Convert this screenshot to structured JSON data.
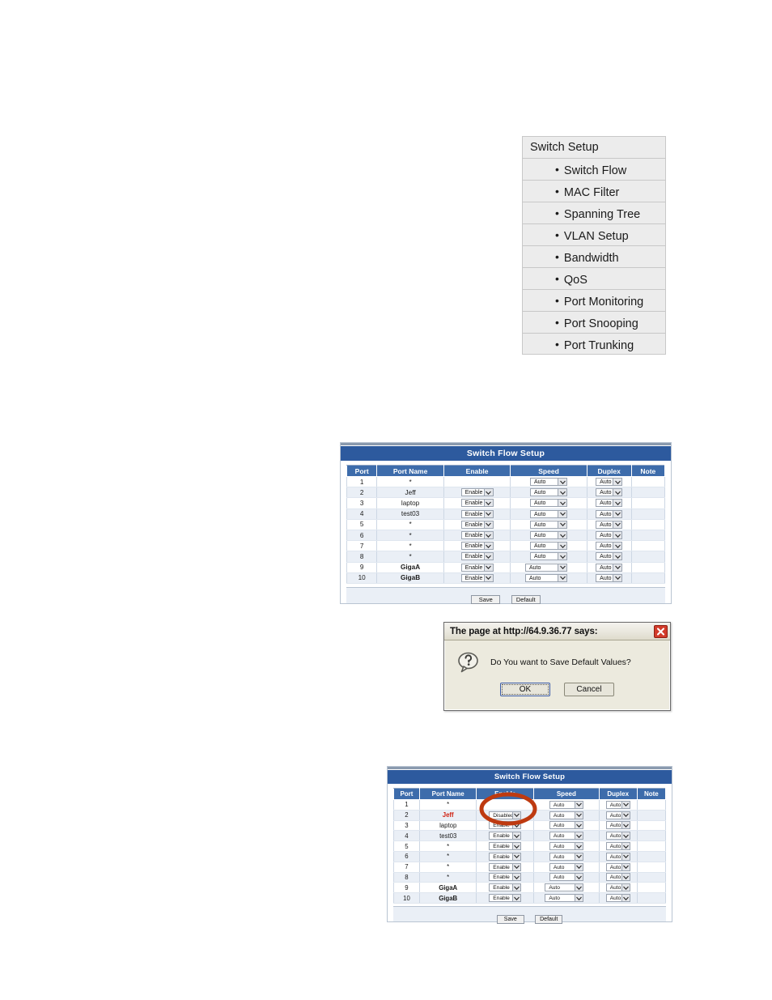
{
  "menu": {
    "title": "Switch Setup",
    "items": [
      "Switch Flow",
      "MAC Filter",
      "Spanning Tree",
      "VLAN Setup",
      "Bandwidth",
      "QoS",
      "Port Monitoring",
      "Port Snooping",
      "Port Trunking"
    ],
    "bullet": "•"
  },
  "table1": {
    "title": "Switch Flow Setup",
    "columns": [
      "Port",
      "Port Name",
      "Enable",
      "Speed",
      "Duplex",
      "Note"
    ],
    "rows": [
      {
        "port": "1",
        "name": "*",
        "enable": "",
        "speed": "Auto",
        "duplex": "Auto",
        "note": "",
        "name_style": "normal",
        "has_enable": false,
        "wide_speed": false
      },
      {
        "port": "2",
        "name": "Jeff",
        "enable": "Enable",
        "speed": "Auto",
        "duplex": "Auto",
        "note": "",
        "name_style": "normal",
        "has_enable": true,
        "wide_speed": false
      },
      {
        "port": "3",
        "name": "laptop",
        "enable": "Enable",
        "speed": "Auto",
        "duplex": "Auto",
        "note": "",
        "name_style": "normal",
        "has_enable": true,
        "wide_speed": false
      },
      {
        "port": "4",
        "name": "test03",
        "enable": "Enable",
        "speed": "Auto",
        "duplex": "Auto",
        "note": "",
        "name_style": "normal",
        "has_enable": true,
        "wide_speed": false
      },
      {
        "port": "5",
        "name": "*",
        "enable": "Enable",
        "speed": "Auto",
        "duplex": "Auto",
        "note": "",
        "name_style": "normal",
        "has_enable": true,
        "wide_speed": false
      },
      {
        "port": "6",
        "name": "*",
        "enable": "Enable",
        "speed": "Auto",
        "duplex": "Auto",
        "note": "",
        "name_style": "normal",
        "has_enable": true,
        "wide_speed": false
      },
      {
        "port": "7",
        "name": "*",
        "enable": "Enable",
        "speed": "Auto",
        "duplex": "Auto",
        "note": "",
        "name_style": "normal",
        "has_enable": true,
        "wide_speed": false
      },
      {
        "port": "8",
        "name": "*",
        "enable": "Enable",
        "speed": "Auto",
        "duplex": "Auto",
        "note": "",
        "name_style": "normal",
        "has_enable": true,
        "wide_speed": false
      },
      {
        "port": "9",
        "name": "GigaA",
        "enable": "Enable",
        "speed": "Auto",
        "duplex": "Auto",
        "note": "",
        "name_style": "bold",
        "has_enable": true,
        "wide_speed": true
      },
      {
        "port": "10",
        "name": "GigaB",
        "enable": "Enable",
        "speed": "Auto",
        "duplex": "Auto",
        "note": "",
        "name_style": "bold",
        "has_enable": true,
        "wide_speed": true
      }
    ],
    "save_label": "Save",
    "default_label": "Default"
  },
  "dialog": {
    "title": "The page at http://64.9.36.77 says:",
    "message": "Do You want to Save Default Values?",
    "ok_label": "OK",
    "cancel_label": "Cancel",
    "close_icon": "close-icon",
    "question_icon": "question-bubble-icon"
  },
  "table2": {
    "title": "Switch Flow Setup",
    "columns": [
      "Port",
      "Port Name",
      "Enable",
      "Speed",
      "Duplex",
      "Note"
    ],
    "rows": [
      {
        "port": "1",
        "name": "*",
        "enable": "",
        "speed": "Auto",
        "duplex": "Auto",
        "note": "",
        "name_style": "normal",
        "has_enable": false,
        "wide_speed": false
      },
      {
        "port": "2",
        "name": "Jeff",
        "enable": "Disabled",
        "speed": "Auto",
        "duplex": "Auto",
        "note": "",
        "name_style": "red",
        "has_enable": true,
        "wide_speed": false
      },
      {
        "port": "3",
        "name": "laptop",
        "enable": "Enable",
        "speed": "Auto",
        "duplex": "Auto",
        "note": "",
        "name_style": "normal",
        "has_enable": true,
        "wide_speed": false
      },
      {
        "port": "4",
        "name": "test03",
        "enable": "Enable",
        "speed": "Auto",
        "duplex": "Auto",
        "note": "",
        "name_style": "normal",
        "has_enable": true,
        "wide_speed": false
      },
      {
        "port": "5",
        "name": "*",
        "enable": "Enable",
        "speed": "Auto",
        "duplex": "Auto",
        "note": "",
        "name_style": "normal",
        "has_enable": true,
        "wide_speed": false
      },
      {
        "port": "6",
        "name": "*",
        "enable": "Enable",
        "speed": "Auto",
        "duplex": "Auto",
        "note": "",
        "name_style": "normal",
        "has_enable": true,
        "wide_speed": false
      },
      {
        "port": "7",
        "name": "*",
        "enable": "Enable",
        "speed": "Auto",
        "duplex": "Auto",
        "note": "",
        "name_style": "normal",
        "has_enable": true,
        "wide_speed": false
      },
      {
        "port": "8",
        "name": "*",
        "enable": "Enable",
        "speed": "Auto",
        "duplex": "Auto",
        "note": "",
        "name_style": "normal",
        "has_enable": true,
        "wide_speed": false
      },
      {
        "port": "9",
        "name": "GigaA",
        "enable": "Enable",
        "speed": "Auto",
        "duplex": "Auto",
        "note": "",
        "name_style": "bold",
        "has_enable": true,
        "wide_speed": true
      },
      {
        "port": "10",
        "name": "GigaB",
        "enable": "Enable",
        "speed": "Auto",
        "duplex": "Auto",
        "note": "",
        "name_style": "bold",
        "has_enable": true,
        "wide_speed": true
      }
    ],
    "save_label": "Save",
    "default_label": "Default",
    "annotation": {
      "shape": "ellipse",
      "color": "#BE3A10",
      "target": "enable-dropdown-port-2"
    }
  },
  "colors": {
    "title_bar_blue": "#2D5A9E",
    "column_header_blue": "#3D6CAB",
    "row_alt": "#EAEFF6",
    "menu_gray": "#ECECEC",
    "annotation_orange": "#BE3A10",
    "red_text": "#D02010"
  }
}
